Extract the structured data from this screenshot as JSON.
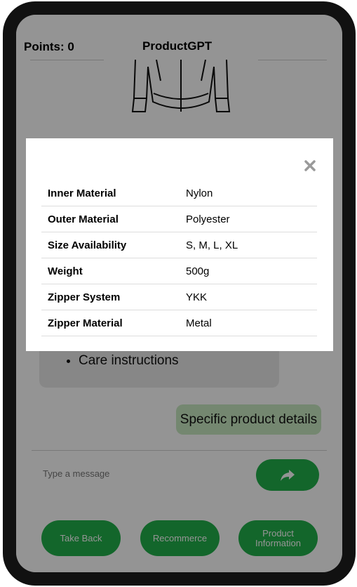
{
  "header": {
    "points_label": "Points: 0",
    "title": "ProductGPT"
  },
  "chat": {
    "bot_list": [
      "Care instructions"
    ],
    "user_message": "Specific product details"
  },
  "input": {
    "placeholder": "Type a message"
  },
  "icons": {
    "send": "share-arrow-icon",
    "close": "close-icon",
    "product": "jacket-icon"
  },
  "bottom_buttons": {
    "take_back": "Take Back",
    "recommerce": "Recommerce",
    "product_information": "Product Information"
  },
  "modal": {
    "specs": [
      {
        "label": "Inner Material",
        "value": "Nylon"
      },
      {
        "label": "Outer Material",
        "value": "Polyester"
      },
      {
        "label": "Size Availability",
        "value": "S, M, L, XL"
      },
      {
        "label": "Weight",
        "value": "500g"
      },
      {
        "label": "Zipper System",
        "value": "YKK"
      },
      {
        "label": "Zipper Material",
        "value": "Metal"
      }
    ]
  },
  "colors": {
    "accent_green": "#22b04b",
    "user_bubble": "#c9e9c2",
    "bot_bubble": "#e9e9e9"
  }
}
